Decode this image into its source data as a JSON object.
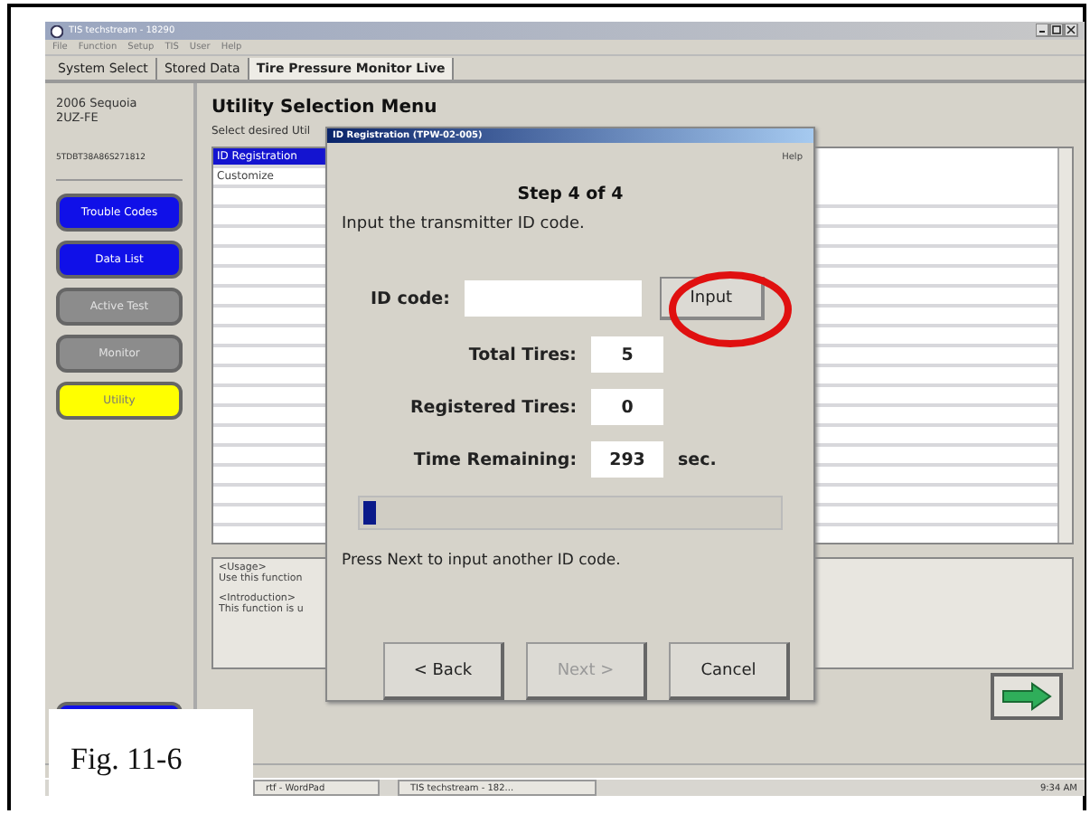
{
  "window": {
    "title": "TIS techstream - 18290"
  },
  "menu": [
    "File",
    "Function",
    "Setup",
    "TIS",
    "User",
    "Help"
  ],
  "tabs": [
    {
      "label": "System Select",
      "selected": false
    },
    {
      "label": "Stored Data",
      "selected": false
    },
    {
      "label": "Tire Pressure Monitor Live",
      "selected": true
    }
  ],
  "vehicle": {
    "model": "2006 Sequoia",
    "engine": "2UZ-FE",
    "vin": "5TDBT38A86S271812"
  },
  "sidebar_buttons": [
    {
      "label": "Trouble Codes",
      "color": "#1010e8",
      "disabled": false
    },
    {
      "label": "Data List",
      "color": "#1010e8",
      "disabled": false
    },
    {
      "label": "Active Test",
      "color": "#8c8c8c",
      "disabled": true
    },
    {
      "label": "Monitor",
      "color": "#8c8c8c",
      "disabled": true
    },
    {
      "label": "Utility",
      "color": "#ffff00",
      "disabled": false
    }
  ],
  "main": {
    "title": "Utility Selection Menu",
    "prompt": "Select desired Util",
    "list": [
      {
        "label": "ID Registration",
        "selected": true
      },
      {
        "label": "Customize",
        "selected": false
      }
    ],
    "description": [
      "<Usage>",
      "Use this function",
      "<Introduction>",
      "This function is u"
    ]
  },
  "dialog": {
    "title": "ID Registration (TPW-02-005)",
    "help": "Help",
    "step": "Step 4 of 4",
    "instruction": "Input the transmitter ID code.",
    "id_label": "ID code:",
    "input_button": "Input",
    "fields": [
      {
        "label": "Total Tires:",
        "value": "5"
      },
      {
        "label": "Registered Tires:",
        "value": "0"
      },
      {
        "label": "Time Remaining:",
        "value": "293",
        "unit": "sec."
      }
    ],
    "progress": {
      "level": 0.03
    },
    "hint": "Press Next to input another ID code.",
    "buttons": [
      {
        "label": "< Back",
        "disabled": false
      },
      {
        "label": "Next >",
        "disabled": true
      },
      {
        "label": "Cancel",
        "disabled": false
      }
    ]
  },
  "taskbar": {
    "items": [
      "rtf - WordPad",
      "TIS techstream - 182..."
    ],
    "clock": "9:34 AM"
  },
  "caption": "Fig. 11-6"
}
